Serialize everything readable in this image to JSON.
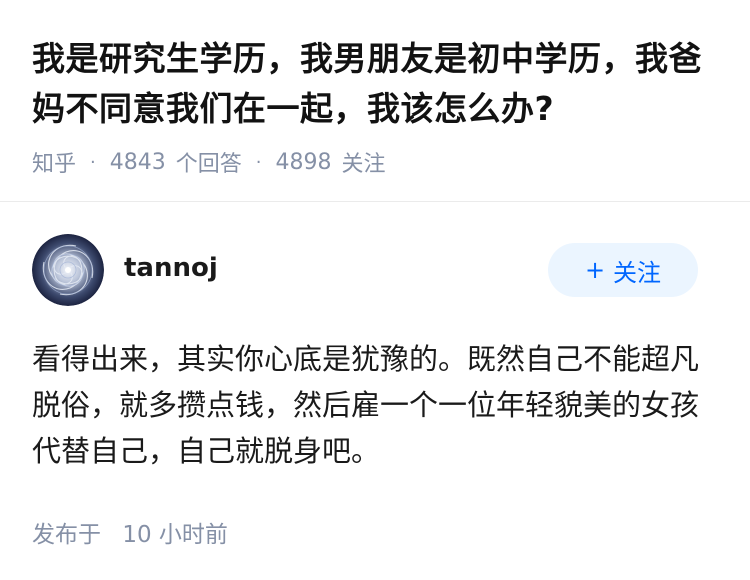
{
  "question": {
    "title": "我是研究生学历，我男朋友是初中学历，我爸妈不同意我们在一起，我该怎么办?",
    "source": "知乎",
    "answers_count": "4843",
    "answers_label": "个回答",
    "followers_count": "4898",
    "followers_label": "关注"
  },
  "answer": {
    "author": {
      "name": "tannoj",
      "avatar_icon": "spiral-avatar-icon"
    },
    "follow_label": "关注",
    "follow_icon": "plus-icon",
    "content": "看得出来，其实你心底是犹豫的。既然自己不能超凡脱俗，就多攒点钱，然后雇一个一位年轻貌美的女孩代替自己，自己就脱身吧。",
    "published_prefix": "发布于",
    "published_time": "10 小时前"
  },
  "colors": {
    "title": "#121212",
    "meta": "#8590a6",
    "accent": "#0066ff",
    "follow_bg": "#ebf5ff",
    "divider": "#ebebeb"
  }
}
